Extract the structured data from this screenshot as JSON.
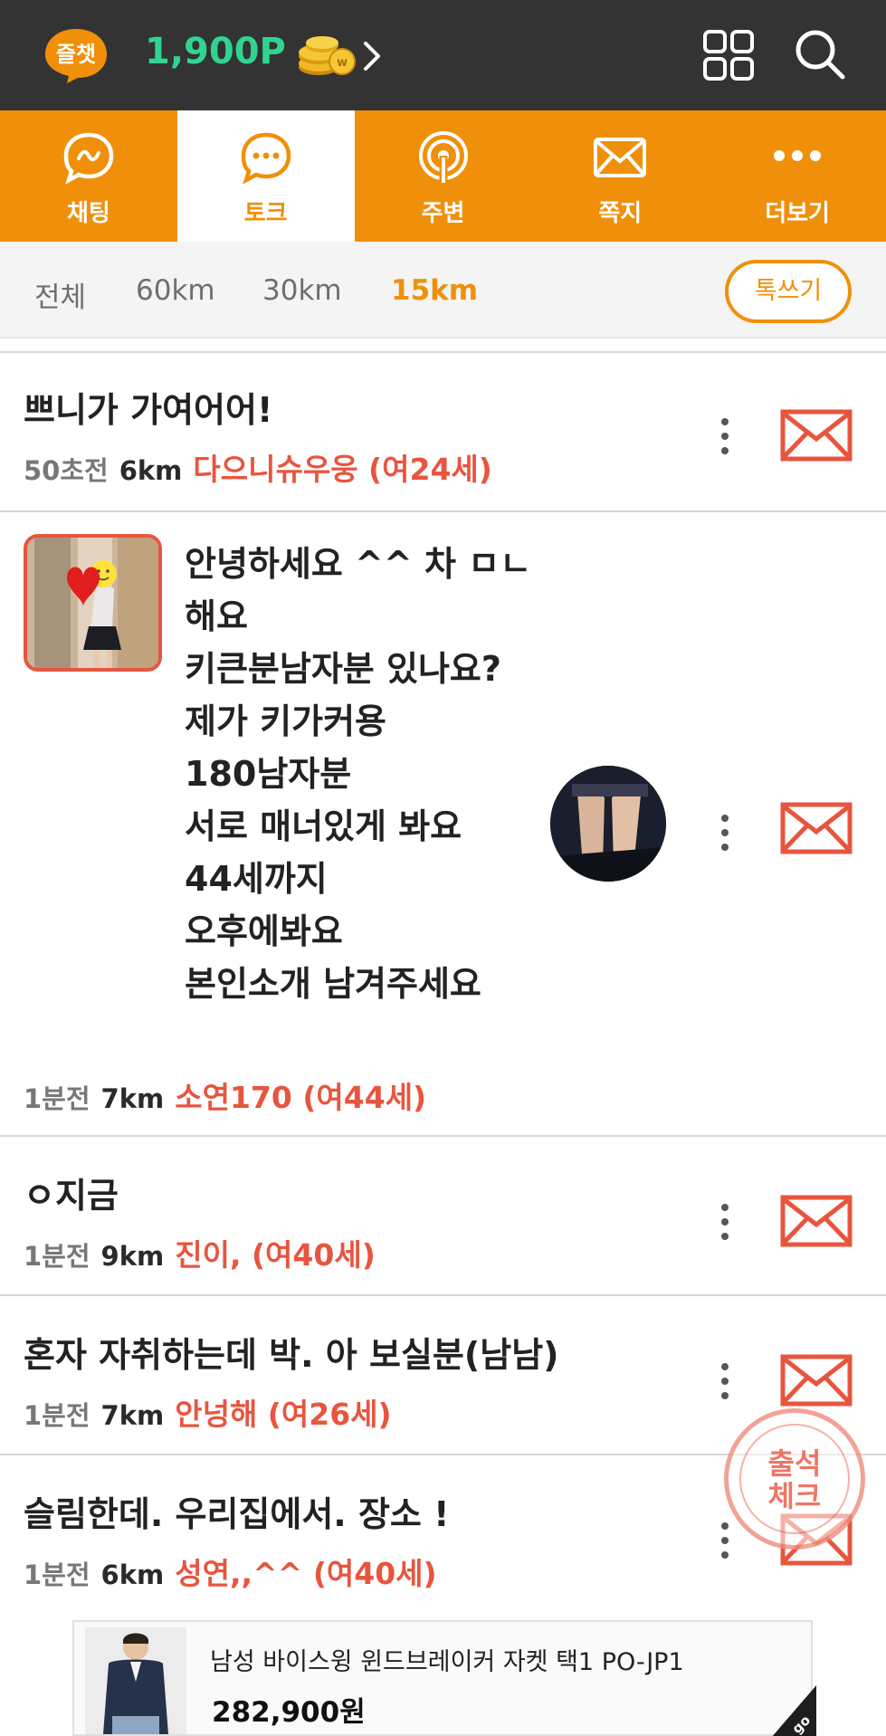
{
  "header": {
    "logo_text": "즐챗",
    "points": "1,900P"
  },
  "tabs": [
    {
      "label": "채팅",
      "icon": "chat-bubble-icon",
      "active": false
    },
    {
      "label": "토크",
      "icon": "talk-bubble-icon",
      "active": true
    },
    {
      "label": "주변",
      "icon": "nearby-signal-icon",
      "active": false
    },
    {
      "label": "쪽지",
      "icon": "envelope-icon",
      "active": false
    },
    {
      "label": "더보기",
      "icon": "more-dots-icon",
      "active": false
    }
  ],
  "filters": [
    "전체",
    "60km",
    "30km",
    "15km"
  ],
  "active_filter": "15km",
  "write_button": "톡쓰기",
  "posts": [
    {
      "title": "쁘니가 가여어어!",
      "ago": "50초전",
      "distance": "6km",
      "author": "다으니슈우웅 (여24세)"
    },
    {
      "lines": [
        "안녕하세요 ^^ 차  ㅁㄴ",
        "해요",
        "키큰분남자분 있나요?",
        "제가 키가커용",
        "180남자분",
        "서로 매너있게 봐요",
        "44세까지",
        "오후에봐요",
        "본인소개 남겨주세요"
      ],
      "ago": "1분전",
      "distance": "7km",
      "author": "소연170 (여44세)"
    },
    {
      "title": "ㅇ지금",
      "ago": "1분전",
      "distance": "9km",
      "author": "진이, (여40세)"
    },
    {
      "title": "혼자 자취하는데 박. 아 보실분(남남)",
      "ago": "1분전",
      "distance": "7km",
      "author": "안넝해 (여26세)"
    },
    {
      "title": "슬림한데.  우리집에서.   장소 !",
      "ago": "1분전",
      "distance": "6km",
      "author": "성연,,^^ (여40세)"
    }
  ],
  "stamp": {
    "line1": "출석",
    "line2": "체크"
  },
  "ad": {
    "title": "남성 바이스윙 윈드브레이커 자켓 택1 PO-JP1",
    "price": "282,900원",
    "corner": "go"
  },
  "colors": {
    "accent": "#f0900a",
    "header_bg": "#333333",
    "points": "#2fd58f",
    "author": "#e8553f"
  }
}
